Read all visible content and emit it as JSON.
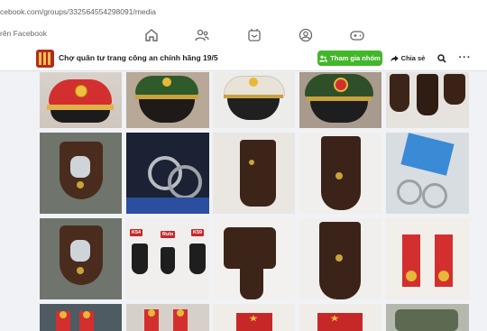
{
  "browser": {
    "url": "cebook.com/groups/332564554298091/media"
  },
  "fbnav": {
    "brand_fragment": "rên Facebook"
  },
  "group": {
    "title": "Chợ quân tư trang công an chính hãng 19/5",
    "join_label": "Tham gia nhóm",
    "share_label": "Chia sẻ"
  },
  "photo_labels": {
    "k54": "K54",
    "rulo": "Rulo",
    "k59": "K59"
  },
  "colors": {
    "join_green": "#42b72a",
    "nav_icon": "#65676b"
  },
  "icons": [
    "home-icon",
    "people-icon",
    "marketplace-icon",
    "groups-icon",
    "gaming-icon",
    "search-icon",
    "share-icon",
    "more-icon"
  ]
}
